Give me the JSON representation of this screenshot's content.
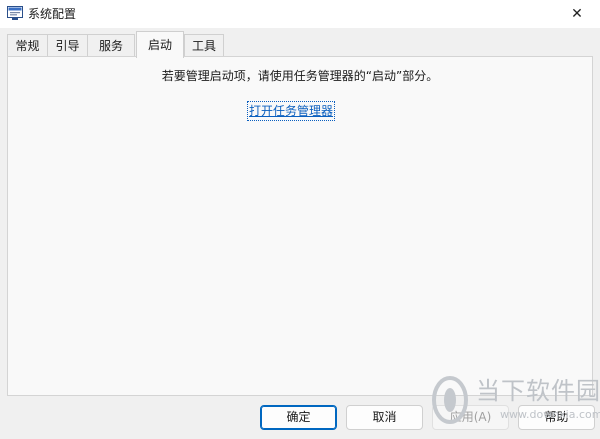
{
  "window": {
    "title": "系统配置",
    "close_glyph": "✕"
  },
  "tabs": [
    {
      "label": "常规"
    },
    {
      "label": "引导"
    },
    {
      "label": "服务"
    },
    {
      "label": "启动",
      "active": true
    },
    {
      "label": "工具"
    }
  ],
  "startup": {
    "message": "若要管理启动项，请使用任务管理器的“启动”部分。",
    "link_label": "打开任务管理器"
  },
  "buttons": {
    "ok_label": "确定",
    "cancel_label": "取消",
    "apply_label": "应用(A)",
    "help_label": "帮助"
  },
  "watermark": {
    "name": "当下软件园",
    "url": "www.downxia.com"
  },
  "colors": {
    "link": "#0a5fbf",
    "primary_border": "#0067c0"
  },
  "icons": {
    "app": "msconfig-icon",
    "close": "close-icon"
  }
}
